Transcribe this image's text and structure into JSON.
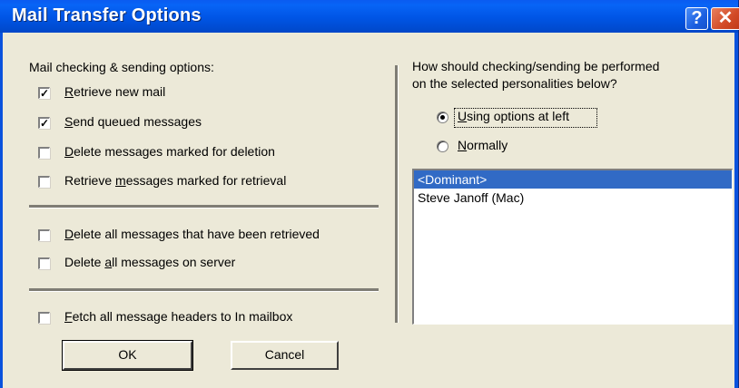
{
  "window": {
    "title": "Mail Transfer Options",
    "help_label": "?",
    "close_label": "✕"
  },
  "left": {
    "group_label": "Mail checking & sending options:",
    "options": [
      {
        "pre": "",
        "u": "R",
        "post": "etrieve new mail",
        "checked": true
      },
      {
        "pre": "",
        "u": "S",
        "post": "end queued messages",
        "checked": true
      },
      {
        "pre": "",
        "u": "D",
        "post": "elete messages marked for deletion",
        "checked": false
      },
      {
        "pre": "Retrieve ",
        "u": "m",
        "post": "essages marked for retrieval",
        "checked": false
      }
    ],
    "server_options": [
      {
        "pre": "",
        "u": "D",
        "post": "elete all messages that have been retrieved",
        "checked": false
      },
      {
        "pre": "Delete ",
        "u": "a",
        "post": "ll messages on server",
        "checked": false
      }
    ],
    "fetch_option": {
      "pre": "",
      "u": "F",
      "post": "etch all message headers to In mailbox",
      "checked": false
    }
  },
  "right": {
    "question_line1": "How should checking/sending be performed",
    "question_line2": "on the selected personalities below?",
    "radio_using": {
      "pre": "",
      "u": "U",
      "post": "sing options at left",
      "selected": true
    },
    "radio_normally": {
      "pre": "",
      "u": "N",
      "post": "ormally",
      "selected": false
    },
    "personalities": [
      "<Dominant>",
      "Steve Janoff (Mac)"
    ],
    "selected_index": 0
  },
  "buttons": {
    "ok": "OK",
    "cancel": "Cancel"
  }
}
